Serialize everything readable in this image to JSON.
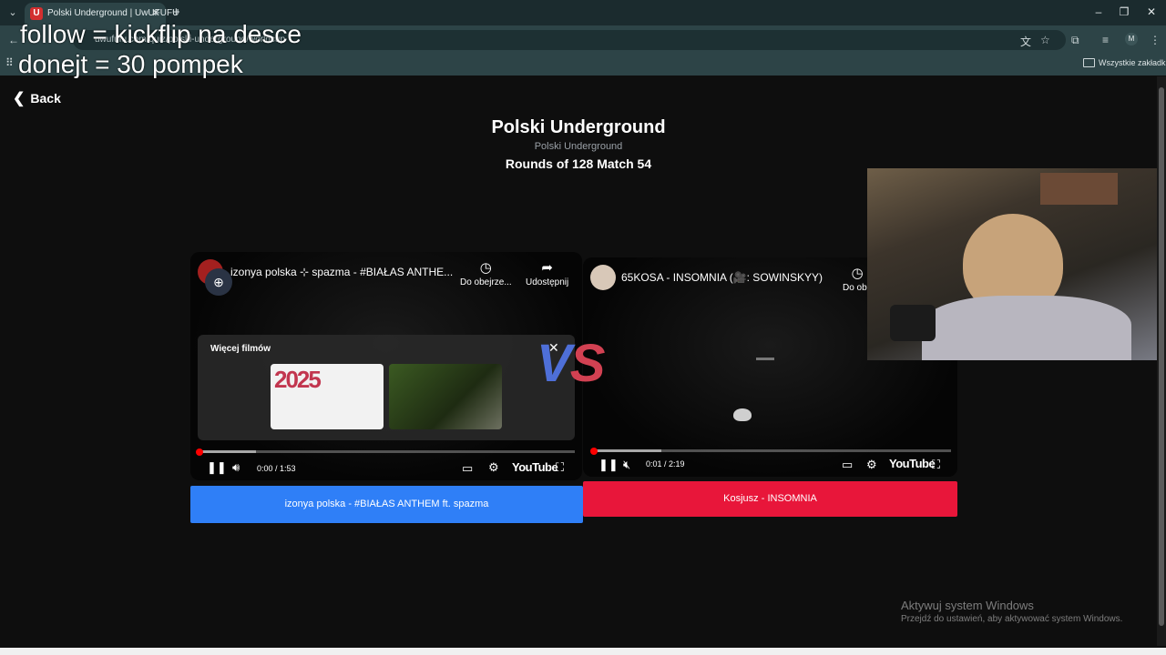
{
  "browser": {
    "tab_title": "Polski Underground | UwUFUFU",
    "favicon_letter": "U",
    "url": "uwufufu.com/quiz/polski-underground/worldcup",
    "bookmarks_label": "Wszystkie zakładki",
    "avatar_letter": "M"
  },
  "overlay": {
    "line1": "follow = kickflip na desce",
    "line2": "donejt = 30 pompek"
  },
  "page": {
    "back_label": "Back",
    "title": "Polski Underground",
    "subtitle": "Polski Underground",
    "round_label": "Rounds of 128 Match 54",
    "vs_v": "V",
    "vs_s": "S"
  },
  "left_video": {
    "title": "izonya polska ⊹ spazma - #BIAŁAS ANTHE...",
    "watch_later": "Do obejrze...",
    "share": "Udostępnij",
    "more_videos": "Więcej filmów",
    "thumb_year": "2025",
    "time": "0:00 / 1:53",
    "progress": 0.15,
    "youtube": "YouTube"
  },
  "right_video": {
    "title": "65KOSA - INSOMNIA (🎥: SOWINSKYY)",
    "watch_later": "Do obe",
    "time": "0:01 / 2:19",
    "progress": 0.19,
    "youtube": "YouTube"
  },
  "choices": {
    "left": "izonya polska - #BIAŁAS ANTHEM ft. spazma",
    "right": "Kosjusz - INSOMNIA"
  },
  "watermark": {
    "line1": "Aktywuj system Windows",
    "line2": "Przejdź do ustawień, aby aktywować system Windows."
  },
  "icons": [
    "search-icon",
    "close-icon",
    "plus-icon",
    "minimize-icon",
    "restore-icon",
    "back-arrow-icon",
    "translate-icon",
    "star-icon",
    "extensions-icon",
    "media-icon",
    "menu-icon",
    "folder-icon",
    "chevron-left-icon",
    "zoom-icon",
    "clock-icon",
    "share-icon",
    "pause-icon",
    "volume-icon",
    "muted-icon",
    "subtitles-icon",
    "settings-icon",
    "fullscreen-icon"
  ],
  "colors": {
    "choice_left": "#2f7ff7",
    "choice_right": "#e8163a",
    "vs_blue": "#4e6fd8",
    "vs_red": "#d24152",
    "progress_red": "#ff0000"
  }
}
